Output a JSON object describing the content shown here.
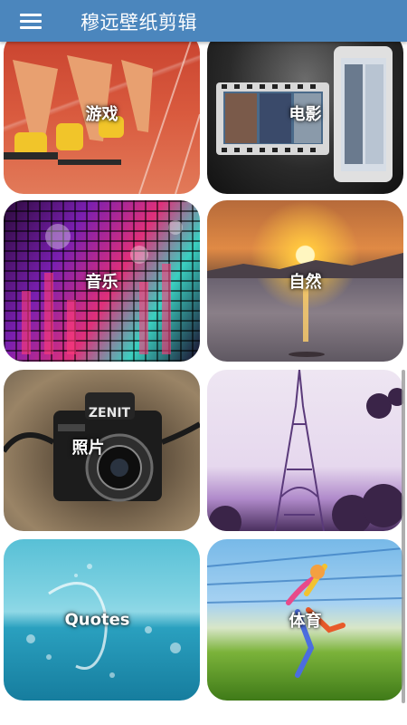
{
  "app": {
    "title": "穆远壁纸剪辑",
    "menu_icon": "menu-icon",
    "bar_color": "#4b86bd"
  },
  "categories": [
    {
      "label": "游戏"
    },
    {
      "label": "电影"
    },
    {
      "label": "音乐"
    },
    {
      "label": "自然"
    },
    {
      "label": "照片"
    },
    {
      "label": ""
    },
    {
      "label": "Quotes"
    },
    {
      "label": "体育"
    }
  ]
}
